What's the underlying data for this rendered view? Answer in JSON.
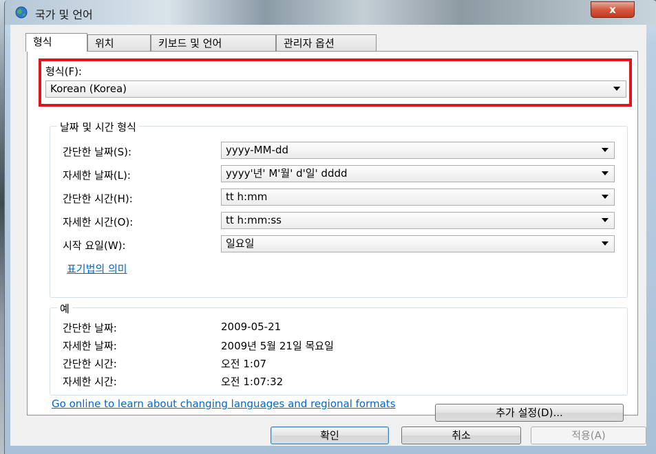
{
  "window": {
    "title": "국가 및 언어",
    "close_label": "x"
  },
  "tabs": [
    {
      "label": "형식",
      "active": true
    },
    {
      "label": "위치"
    },
    {
      "label": "키보드 및 언어"
    },
    {
      "label": "관리자 옵션"
    }
  ],
  "format": {
    "label": "형식(F):",
    "value": "Korean (Korea)"
  },
  "datetime": {
    "group_title": "날짜 및 시간 형식",
    "short_date_label": "간단한 날짜(S):",
    "short_date_value": "yyyy-MM-dd",
    "long_date_label": "자세한 날짜(L):",
    "long_date_value": "yyyy'년' M'월' d'일' dddd",
    "short_time_label": "간단한 시간(H):",
    "short_time_value": "tt h:mm",
    "long_time_label": "자세한 시간(O):",
    "long_time_value": "tt h:mm:ss",
    "first_day_label": "시작 요일(W):",
    "first_day_value": "일요일",
    "notation_link": "표기법의 의미"
  },
  "examples": {
    "group_title": "예",
    "short_date_label": "간단한 날짜:",
    "short_date_value": "2009-05-21",
    "long_date_label": "자세한 날짜:",
    "long_date_value": "2009년 5월 21일 목요일",
    "short_time_label": "간단한 시간:",
    "short_time_value": "오전 1:07",
    "long_time_label": "자세한 시간:",
    "long_time_value": "오전 1:07:32"
  },
  "additional_settings_label": "추가 설정(D)...",
  "online_link": "Go online to learn about changing languages and regional formats",
  "buttons": {
    "ok": "확인",
    "cancel": "취소",
    "apply": "적용(A)"
  },
  "colors": {
    "highlight": "#e0141e",
    "link": "#0066cc"
  }
}
